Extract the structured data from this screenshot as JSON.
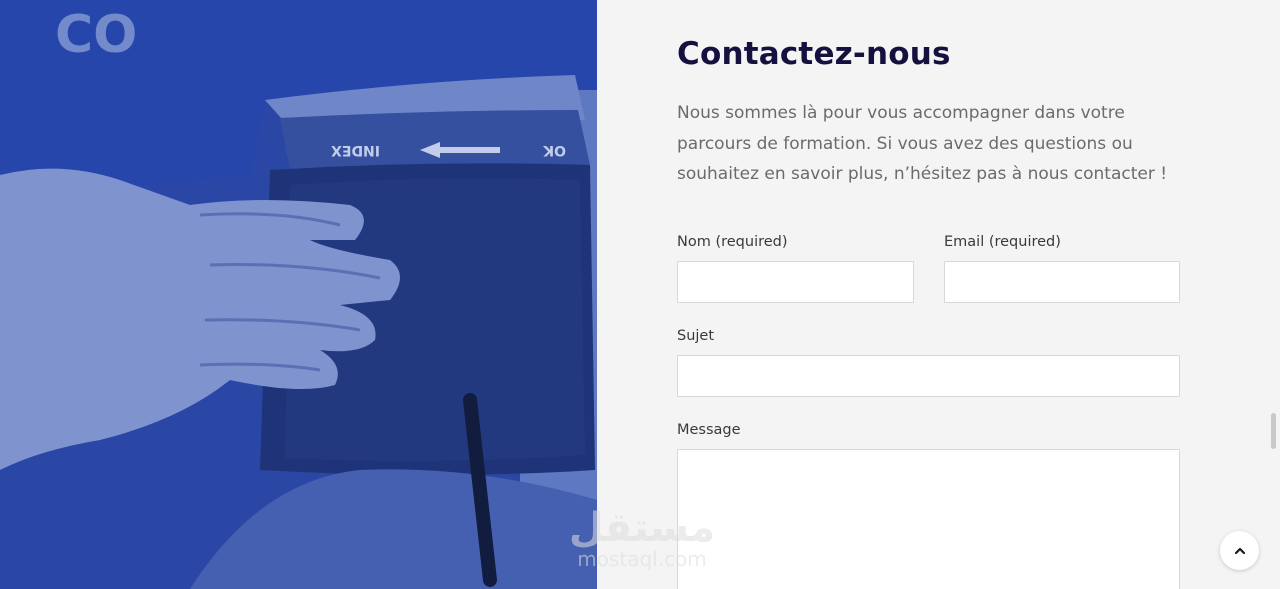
{
  "contact": {
    "title": "Contactez-nous",
    "intro": "Nous sommes là pour vous accompagner dans votre parcours de formation. Si vous avez des questions ou souhaitez en savoir plus, n’hésitez pas à nous contacter !"
  },
  "form": {
    "name_label": "Nom (required)",
    "name_value": "",
    "email_label": "Email (required)",
    "email_value": "",
    "subject_label": "Sujet",
    "subject_value": "",
    "message_label": "Message",
    "message_value": ""
  },
  "photo": {
    "shirt_text": "CO",
    "cuff_text": "INDEX",
    "cuff_ok": "OK",
    "tint_color": "#2541a0"
  },
  "watermark": {
    "logo": "مستقل",
    "url": "mostaql.com"
  },
  "icons": {
    "back_to_top": "chevron-up-icon"
  }
}
